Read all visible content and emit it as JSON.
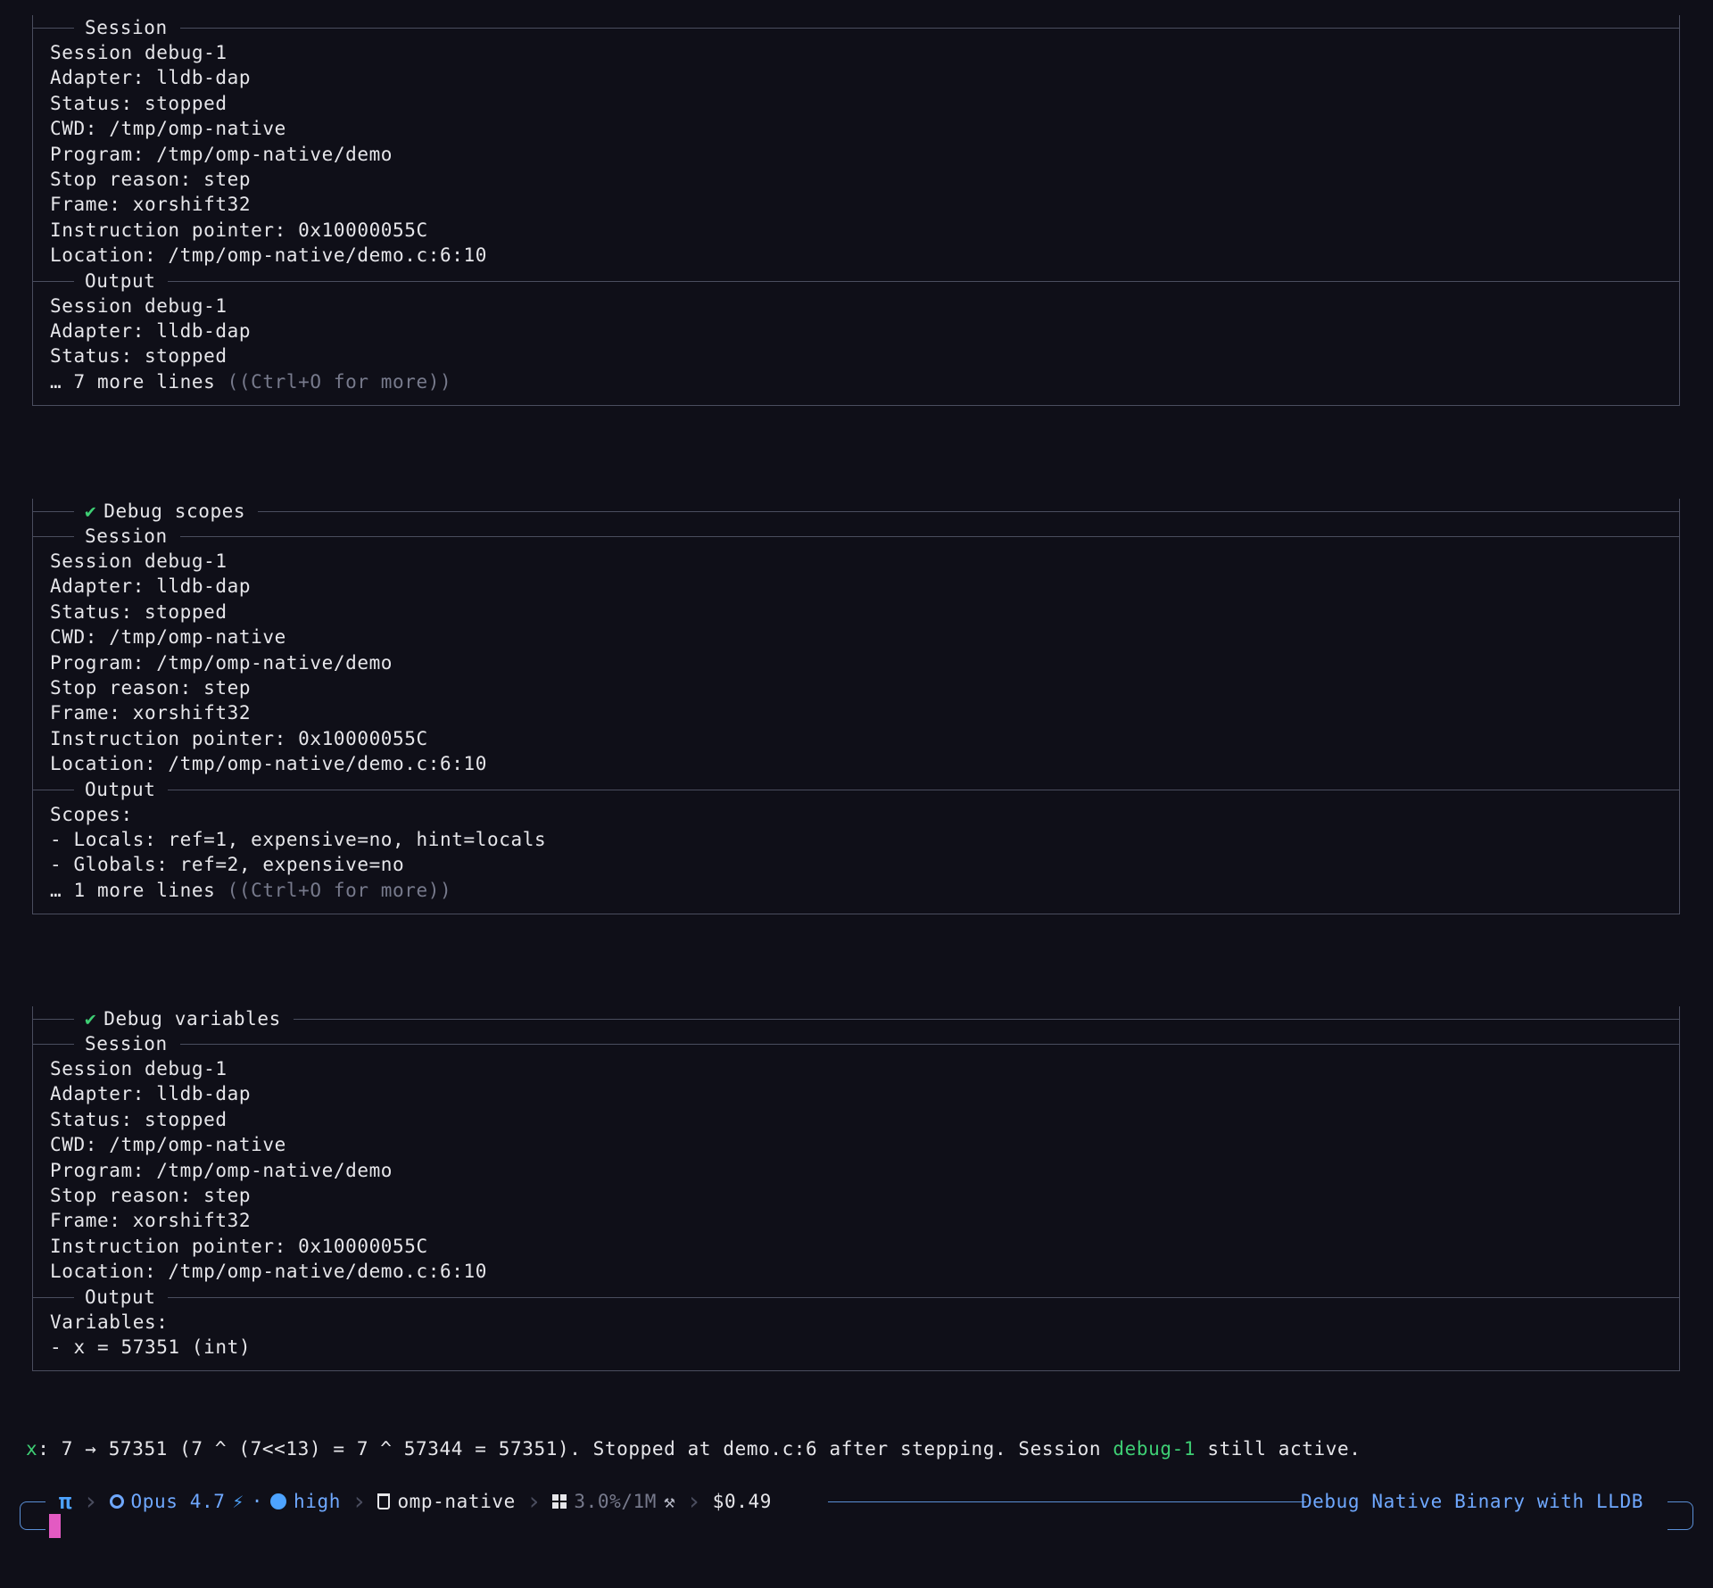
{
  "panels": [
    {
      "title": "",
      "session_heading": "Session",
      "output_heading": "Output",
      "session_lines": [
        "Session debug-1",
        "Adapter: lldb-dap",
        "Status: stopped",
        "CWD: /tmp/omp-native",
        "Program: /tmp/omp-native/demo",
        "Stop reason: step",
        "Frame: xorshift32",
        "Instruction pointer: 0x10000055C",
        "Location: /tmp/omp-native/demo.c:6:10"
      ],
      "output_lines": [
        "Session debug-1",
        "Adapter: lldb-dap",
        "Status: stopped"
      ],
      "more_count": "… 7 more lines",
      "more_hint": " ((Ctrl+O for more))"
    },
    {
      "title": "Debug scopes",
      "session_heading": "Session",
      "output_heading": "Output",
      "session_lines": [
        "Session debug-1",
        "Adapter: lldb-dap",
        "Status: stopped",
        "CWD: /tmp/omp-native",
        "Program: /tmp/omp-native/demo",
        "Stop reason: step",
        "Frame: xorshift32",
        "Instruction pointer: 0x10000055C",
        "Location: /tmp/omp-native/demo.c:6:10"
      ],
      "output_lines": [
        "Scopes:",
        "- Locals: ref=1, expensive=no, hint=locals",
        "- Globals: ref=2, expensive=no"
      ],
      "more_count": "… 1 more lines",
      "more_hint": " ((Ctrl+O for more))"
    },
    {
      "title": "Debug variables",
      "session_heading": "Session",
      "output_heading": "Output",
      "session_lines": [
        "Session debug-1",
        "Adapter: lldb-dap",
        "Status: stopped",
        "CWD: /tmp/omp-native",
        "Program: /tmp/omp-native/demo",
        "Stop reason: step",
        "Frame: xorshift32",
        "Instruction pointer: 0x10000055C",
        "Location: /tmp/omp-native/demo.c:6:10"
      ],
      "output_lines": [
        "Variables:",
        "- x = 57351 (int)"
      ]
    }
  ],
  "summary": {
    "var_name": "x",
    "text_before": ": 7 → 57351 (7 ^ (7<<13) = 7 ^ 57344 = 57351). Stopped at demo.c:6 after stepping. Session ",
    "session_name": "debug-1",
    "text_after": " still active."
  },
  "statusbar": {
    "logo": "π",
    "model_name": "Opus 4.7",
    "effort": "high",
    "project": "omp-native",
    "context_usage": "3.0%/1M",
    "cost": "$0.49",
    "title": "Debug Native Binary with LLDB",
    "icons": {
      "logo": "pi-icon",
      "model": "model-icon",
      "fast": "lightning-icon",
      "effort": "effort-dot-icon",
      "project": "trash-icon",
      "context": "windows-icon",
      "tools": "wand-icon"
    }
  },
  "colors": {
    "background": "#0f0f18",
    "border": "#4a4d5e",
    "accent_blue": "#6fa8ff",
    "success_green": "#3ecf74",
    "cursor_pink": "#e35ac2"
  }
}
